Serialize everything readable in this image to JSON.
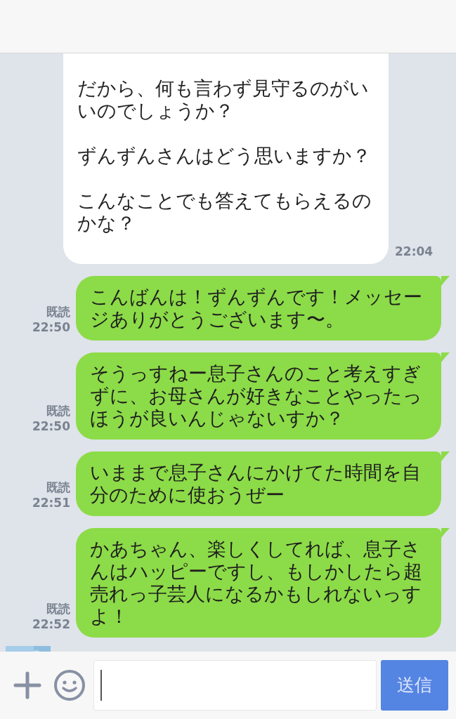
{
  "messages": [
    {
      "kind": "incoming",
      "paragraphs": [
        "だから、何も言わず見守るのがいいのでしょうか？",
        "ずんずんさんはどう思いますか？",
        "こんなことでも答えてもらえるのかな？"
      ],
      "time": "22:04"
    },
    {
      "kind": "outgoing",
      "text": "こんばんは！ずんずんです！メッセージありがとうございます〜。",
      "read": "既読",
      "time": "22:50"
    },
    {
      "kind": "outgoing",
      "text": "そうっすねー息子さんのこと考えすぎずに、お母さんが好きなことやったっほうが良いんじゃないすか？",
      "read": "既読",
      "time": "22:50"
    },
    {
      "kind": "outgoing",
      "text": "いままで息子さんにかけてた時間を自分のために使おうぜー",
      "read": "既読",
      "time": "22:51"
    },
    {
      "kind": "outgoing",
      "text": "かあちゃん、楽しくしてれば、息子さんはハッピーですし、もしかしたら超売れっ子芸人になるかもしれないっすよ！",
      "read": "既読",
      "time": "22:52"
    },
    {
      "kind": "avatar"
    }
  ],
  "composer": {
    "send": "送信"
  }
}
